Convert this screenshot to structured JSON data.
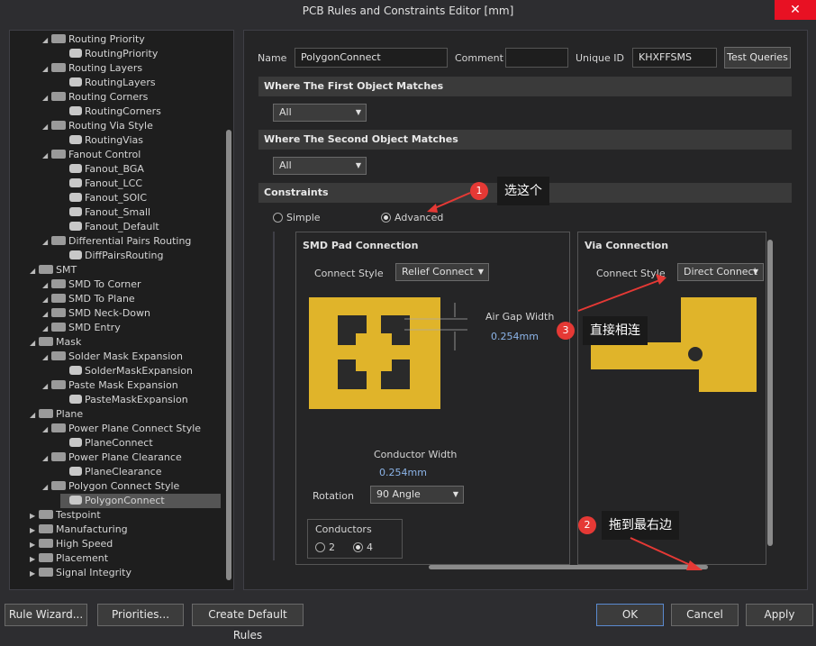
{
  "window": {
    "title": "PCB Rules and Constraints Editor [mm]",
    "close_glyph": "✕"
  },
  "tree": {
    "items": [
      {
        "label": "Routing Priority",
        "level": 2,
        "kind": "cat"
      },
      {
        "label": "RoutingPriority",
        "level": 3,
        "kind": "rule"
      },
      {
        "label": "Routing Layers",
        "level": 2,
        "kind": "cat"
      },
      {
        "label": "RoutingLayers",
        "level": 3,
        "kind": "rule"
      },
      {
        "label": "Routing Corners",
        "level": 2,
        "kind": "cat"
      },
      {
        "label": "RoutingCorners",
        "level": 3,
        "kind": "rule"
      },
      {
        "label": "Routing Via Style",
        "level": 2,
        "kind": "cat"
      },
      {
        "label": "RoutingVias",
        "level": 3,
        "kind": "rule"
      },
      {
        "label": "Fanout Control",
        "level": 2,
        "kind": "cat"
      },
      {
        "label": "Fanout_BGA",
        "level": 3,
        "kind": "rule"
      },
      {
        "label": "Fanout_LCC",
        "level": 3,
        "kind": "rule"
      },
      {
        "label": "Fanout_SOIC",
        "level": 3,
        "kind": "rule"
      },
      {
        "label": "Fanout_Small",
        "level": 3,
        "kind": "rule"
      },
      {
        "label": "Fanout_Default",
        "level": 3,
        "kind": "rule"
      },
      {
        "label": "Differential Pairs Routing",
        "level": 2,
        "kind": "cat"
      },
      {
        "label": "DiffPairsRouting",
        "level": 3,
        "kind": "rule"
      },
      {
        "label": "SMT",
        "level": 1,
        "kind": "cat"
      },
      {
        "label": "SMD To Corner",
        "level": 2,
        "kind": "cat"
      },
      {
        "label": "SMD To Plane",
        "level": 2,
        "kind": "cat"
      },
      {
        "label": "SMD Neck-Down",
        "level": 2,
        "kind": "cat"
      },
      {
        "label": "SMD Entry",
        "level": 2,
        "kind": "cat"
      },
      {
        "label": "Mask",
        "level": 1,
        "kind": "cat"
      },
      {
        "label": "Solder Mask Expansion",
        "level": 2,
        "kind": "cat"
      },
      {
        "label": "SolderMaskExpansion",
        "level": 3,
        "kind": "rule"
      },
      {
        "label": "Paste Mask Expansion",
        "level": 2,
        "kind": "cat"
      },
      {
        "label": "PasteMaskExpansion",
        "level": 3,
        "kind": "rule"
      },
      {
        "label": "Plane",
        "level": 1,
        "kind": "cat"
      },
      {
        "label": "Power Plane Connect Style",
        "level": 2,
        "kind": "cat"
      },
      {
        "label": "PlaneConnect",
        "level": 3,
        "kind": "rule"
      },
      {
        "label": "Power Plane Clearance",
        "level": 2,
        "kind": "cat"
      },
      {
        "label": "PlaneClearance",
        "level": 3,
        "kind": "rule"
      },
      {
        "label": "Polygon Connect Style",
        "level": 2,
        "kind": "cat"
      },
      {
        "label": "PolygonConnect",
        "level": 3,
        "kind": "rule",
        "selected": true
      },
      {
        "label": "Testpoint",
        "level": 1,
        "kind": "cat"
      },
      {
        "label": "Manufacturing",
        "level": 1,
        "kind": "cat"
      },
      {
        "label": "High Speed",
        "level": 1,
        "kind": "cat"
      },
      {
        "label": "Placement",
        "level": 1,
        "kind": "cat"
      },
      {
        "label": "Signal Integrity",
        "level": 1,
        "kind": "cat"
      }
    ]
  },
  "header": {
    "name_label": "Name",
    "name_value": "PolygonConnect",
    "comment_label": "Comment",
    "comment_value": "",
    "uid_label": "Unique ID",
    "uid_value": "KHXFFSMS",
    "test_queries": "Test Queries"
  },
  "first_match": {
    "title": "Where The First Object Matches",
    "value": "All"
  },
  "second_match": {
    "title": "Where The Second Object Matches",
    "value": "All"
  },
  "constraints": {
    "title": "Constraints",
    "simple_label": "Simple",
    "advanced_label": "Advanced",
    "smd": {
      "title": "SMD Pad Connection",
      "connect_style_label": "Connect Style",
      "connect_style_value": "Relief Connect",
      "air_gap_label": "Air Gap Width",
      "air_gap_value": "0.254mm",
      "conductor_width_label": "Conductor Width",
      "conductor_width_value": "0.254mm",
      "rotation_label": "Rotation",
      "rotation_value": "90 Angle",
      "conductors_label": "Conductors",
      "conductors_opt1": "2",
      "conductors_opt2": "4"
    },
    "via": {
      "title": "Via Connection",
      "connect_style_label": "Connect Style",
      "connect_style_value": "Direct Connect"
    }
  },
  "annotations": {
    "a1_num": "1",
    "a1_text": "选这个",
    "a2_num": "2",
    "a2_text": "拖到最右边",
    "a3_num": "3",
    "a3_text": "直接相连"
  },
  "footer": {
    "rule_wizard": "Rule Wizard...",
    "priorities": "Priorities...",
    "create_default": "Create Default Rules",
    "ok": "OK",
    "cancel": "Cancel",
    "apply": "Apply"
  },
  "colors": {
    "pad_gold": "#e0b42a",
    "annotation_red": "#e53935",
    "bg": "#2d2d30"
  }
}
